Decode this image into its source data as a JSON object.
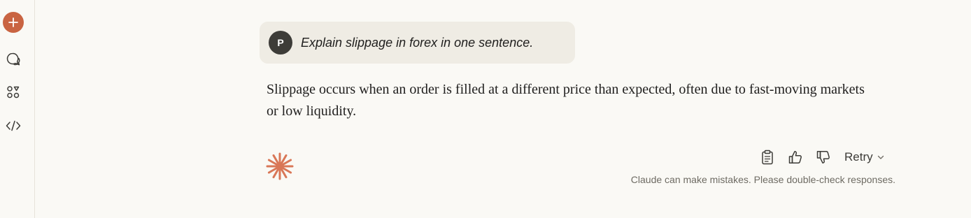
{
  "sidebar": {
    "items": [
      {
        "icon": "plus-icon"
      },
      {
        "icon": "chat-bubbles-icon"
      },
      {
        "icon": "projects-icon"
      },
      {
        "icon": "code-icon"
      }
    ],
    "accent_color": "#c96442"
  },
  "conversation": {
    "user": {
      "avatar_initial": "P",
      "message": "Explain slippage in forex in one sentence."
    },
    "assistant": {
      "response": "Slippage occurs when an order is filled at a different price than expected, often due to fast-moving markets or low liquidity."
    }
  },
  "actions": {
    "copy_icon": "clipboard-icon",
    "thumbs_up_icon": "thumbs-up-icon",
    "thumbs_down_icon": "thumbs-down-icon",
    "retry_label": "Retry"
  },
  "disclaimer": "Claude can make mistakes. Please double-check responses.",
  "colors": {
    "background": "#faf9f5",
    "user_bubble": "#efece4",
    "brand": "#c96442",
    "avatar": "#3d3c38"
  }
}
